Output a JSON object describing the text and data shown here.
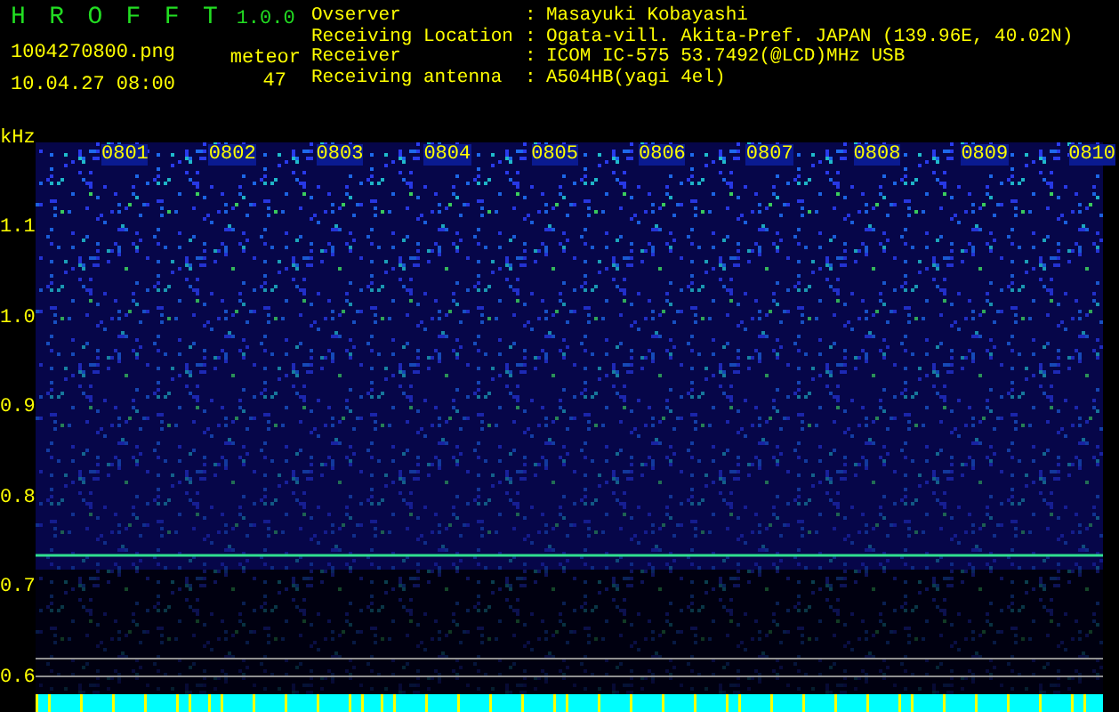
{
  "app": {
    "title": "H R O F F T",
    "version": "1.0.0"
  },
  "file": "1004270800.png",
  "timestamp": "10.04.27 08:00",
  "counter": {
    "label": "meteor",
    "value": "47"
  },
  "info": [
    {
      "label": "Ovserver",
      "separator": ":",
      "value": "Masayuki Kobayashi"
    },
    {
      "label": "Receiving Location",
      "separator": ":",
      "value": "Ogata-vill. Akita-Pref. JAPAN (139.96E, 40.02N)"
    },
    {
      "label": "Receiver",
      "separator": ":",
      "value": "ICOM IC-575 53.7492(@LCD)MHz USB"
    },
    {
      "label": "Receiving antenna",
      "separator": ":",
      "value": "A504HB(yagi 4el)"
    }
  ],
  "spectrogram": {
    "unit": "kHz",
    "time_labels": [
      "0801",
      "0802",
      "0803",
      "0804",
      "0805",
      "0806",
      "0807",
      "0808",
      "0809",
      "0810"
    ],
    "frequency_labels": [
      "1.1",
      "1.0",
      "0.9",
      "0.8",
      "0.7",
      "0.6"
    ]
  }
}
